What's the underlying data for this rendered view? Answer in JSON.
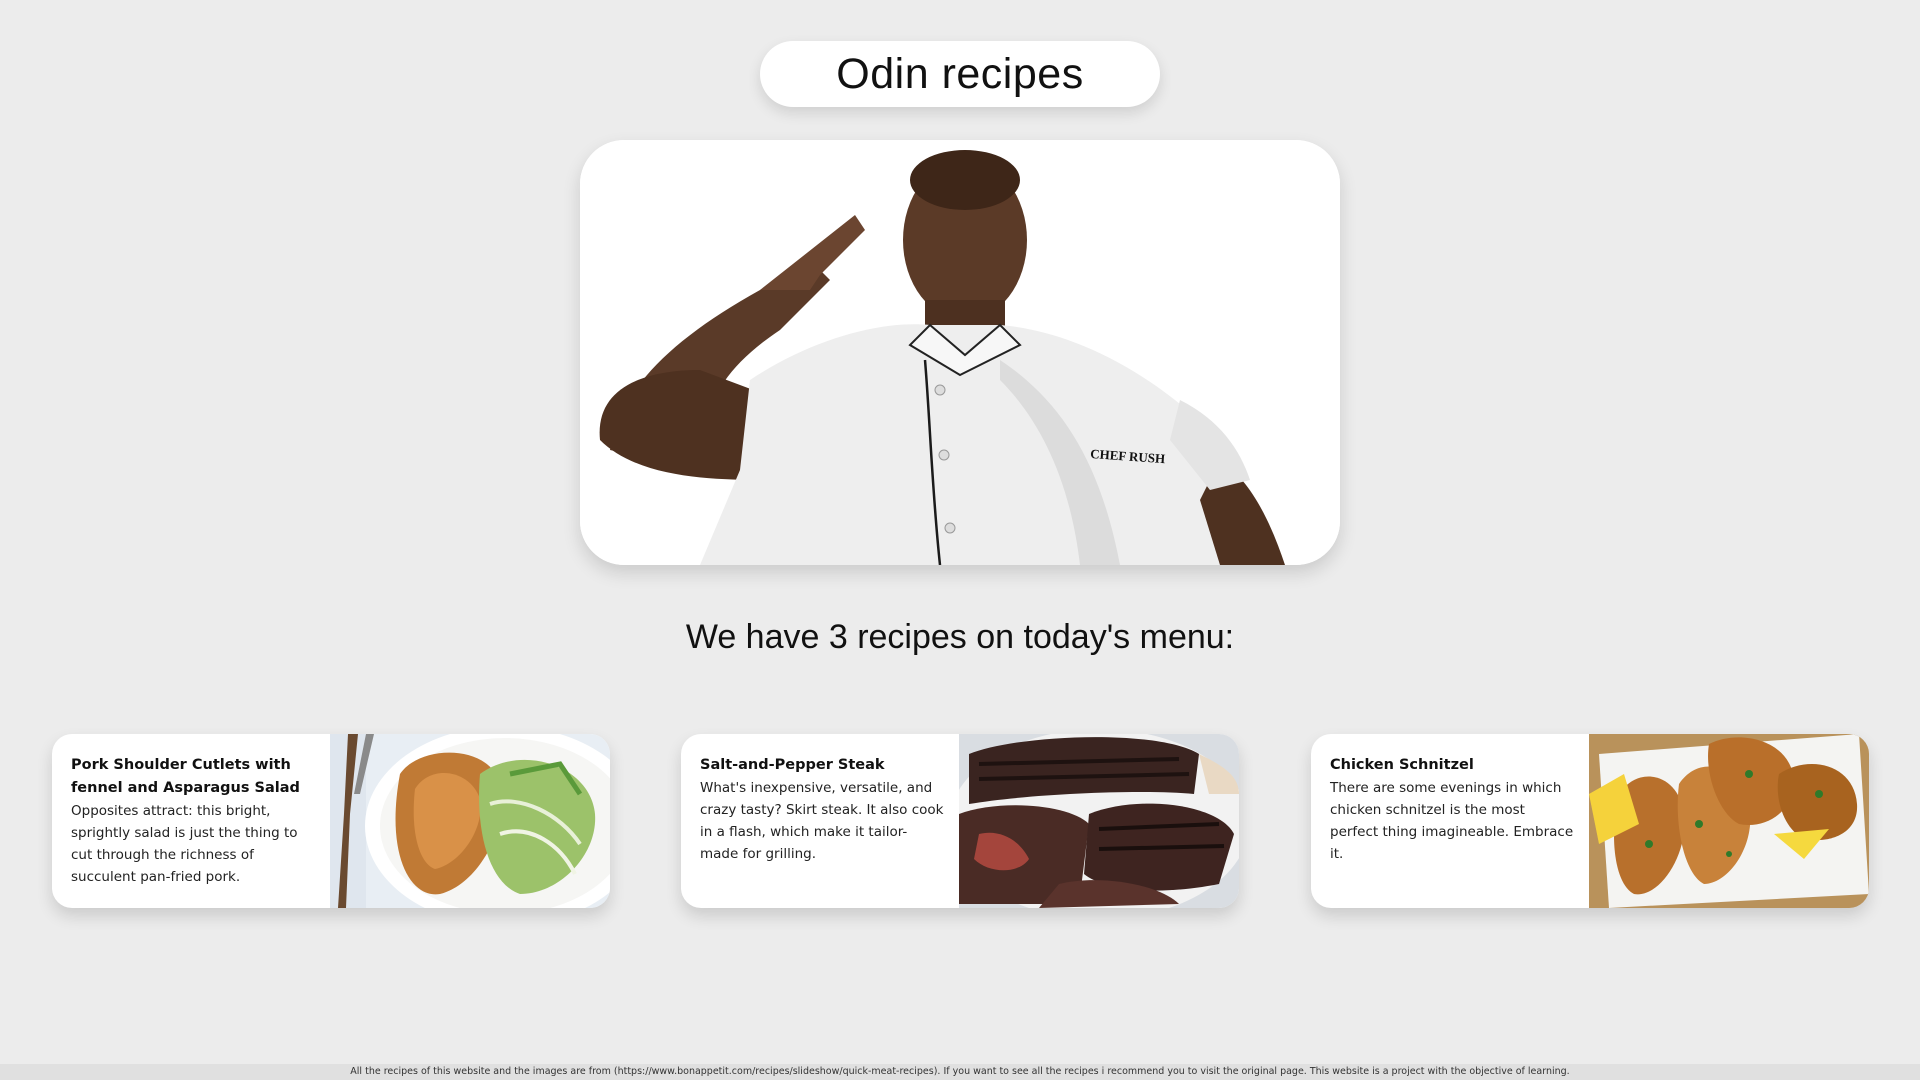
{
  "header": {
    "title": "Odin recipes"
  },
  "hero": {
    "image_alt": "Chef saluting",
    "shirt_text": "CHEF RUSH"
  },
  "subheading": "We have 3 recipes on today's menu:",
  "recipes": [
    {
      "title": "Pork Shoulder Cutlets with fennel and Asparagus Salad",
      "description": "Opposites attract: this bright, sprightly salad is just the thing to cut through the richness of succulent pan-fried pork.",
      "image_alt": "Pork cutlets with fennel and asparagus salad"
    },
    {
      "title": "Salt-and-Pepper Steak",
      "description": "What's inexpensive, versatile, and crazy tasty? Skirt steak. It also cook in a flash, which make it tailor-made for grilling.",
      "image_alt": "Sliced skirt steak on a plate"
    },
    {
      "title": "Chicken Schnitzel",
      "description": "There are some evenings in which chicken schnitzel is the most perfect thing imagineable. Embrace it.",
      "image_alt": "Chicken schnitzel with lemon wedges"
    }
  ],
  "footer": {
    "text": "All the recipes of this website and the images are from (https://www.bonappetit.com/recipes/slideshow/quick-meat-recipes). If you want to see all the recipes i recommend you to visit the original page. This website is a project with the objective of learning."
  },
  "colors": {
    "background": "#ececec",
    "card": "#ffffff",
    "footer_bar": "#e0e0e0"
  }
}
